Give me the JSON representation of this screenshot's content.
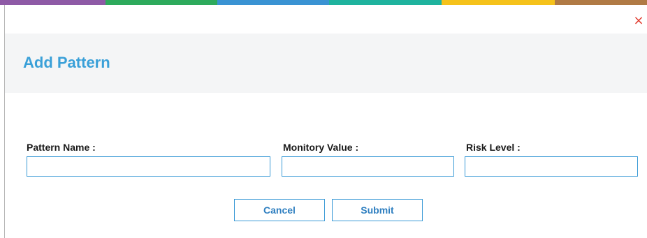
{
  "window": {
    "title": "Add Pattern",
    "close_icon": "close-icon",
    "close_glyph": "×",
    "accent_colors": [
      "#8e5aa6",
      "#2eaa5c",
      "#3a93d3",
      "#1fb39e",
      "#f5c21b",
      "#b07a45"
    ],
    "title_color": "#3aa0d8",
    "close_color": "#e03b2e",
    "border_color": "#3a9ad6"
  },
  "form": {
    "fields": [
      {
        "label": "Pattern Name :",
        "value": "",
        "placeholder": ""
      },
      {
        "label": "Monitory Value :",
        "value": "",
        "placeholder": ""
      },
      {
        "label": "Risk Level :",
        "value": "",
        "placeholder": ""
      }
    ]
  },
  "actions": {
    "cancel_label": "Cancel",
    "submit_label": "Submit"
  }
}
